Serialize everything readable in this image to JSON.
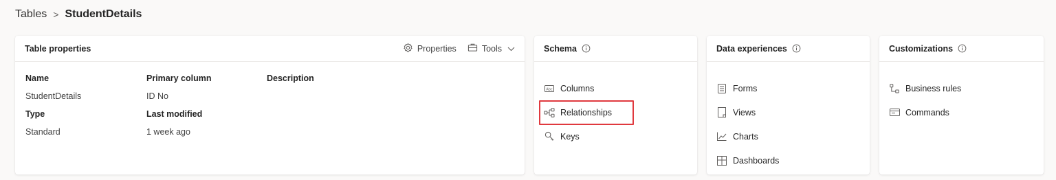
{
  "breadcrumb": {
    "root": "Tables",
    "separator": ">",
    "current": "StudentDetails"
  },
  "table_properties": {
    "title": "Table properties",
    "actions": {
      "properties_label": "Properties",
      "tools_label": "Tools"
    },
    "fields": {
      "name_label": "Name",
      "name_value": "StudentDetails",
      "primary_label": "Primary column",
      "primary_value": "ID No",
      "description_label": "Description",
      "type_label": "Type",
      "type_value": "Standard",
      "modified_label": "Last modified",
      "modified_value": "1 week ago"
    }
  },
  "schema": {
    "title": "Schema",
    "items": [
      {
        "label": "Columns",
        "icon": "columns-icon"
      },
      {
        "label": "Relationships",
        "icon": "relationships-icon",
        "highlighted": true
      },
      {
        "label": "Keys",
        "icon": "key-icon"
      }
    ]
  },
  "data_experiences": {
    "title": "Data experiences",
    "items": [
      {
        "label": "Forms",
        "icon": "form-icon"
      },
      {
        "label": "Views",
        "icon": "view-icon"
      },
      {
        "label": "Charts",
        "icon": "chart-icon"
      },
      {
        "label": "Dashboards",
        "icon": "dashboard-icon"
      }
    ]
  },
  "customizations": {
    "title": "Customizations",
    "items": [
      {
        "label": "Business rules",
        "icon": "business-rules-icon"
      },
      {
        "label": "Commands",
        "icon": "commands-icon"
      }
    ]
  },
  "colors": {
    "highlight": "#e0393e",
    "background": "#faf9f8",
    "card": "#ffffff"
  }
}
